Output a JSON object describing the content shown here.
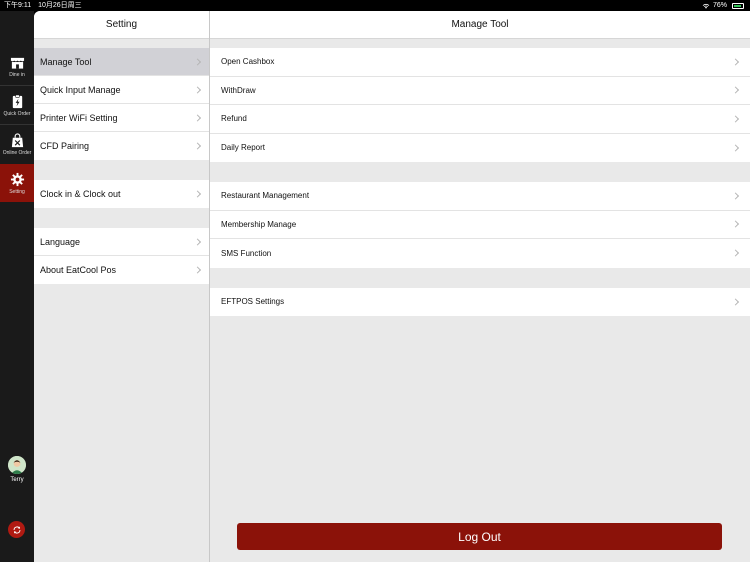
{
  "status_bar": {
    "time": "下午9:11",
    "date": "10月26日周三",
    "battery": "76%"
  },
  "rail": {
    "items": [
      {
        "label": "Dine in"
      },
      {
        "label": "Quick Order"
      },
      {
        "label": "Online Order"
      },
      {
        "label": "Setting"
      }
    ],
    "user_name": "Terry"
  },
  "left_panel": {
    "title": "Setting",
    "groups": [
      [
        "Manage Tool",
        "Quick Input Manage",
        "Printer WiFi Setting",
        "CFD Pairing"
      ],
      [
        "Clock in & Clock out"
      ],
      [
        "Language",
        "About EatCool Pos"
      ]
    ]
  },
  "right_panel": {
    "title": "Manage Tool",
    "groups": [
      [
        "Open Cashbox",
        "WithDraw",
        "Refund",
        "Daily Report"
      ],
      [
        "Restaurant Management",
        "Membership Manage",
        "SMS Function"
      ],
      [
        "EFTPOS Settings"
      ]
    ],
    "logout_label": "Log Out"
  },
  "colors": {
    "accent": "#8b1209",
    "selected_row": "#d1d1d6",
    "background": "#e9e9e9"
  }
}
